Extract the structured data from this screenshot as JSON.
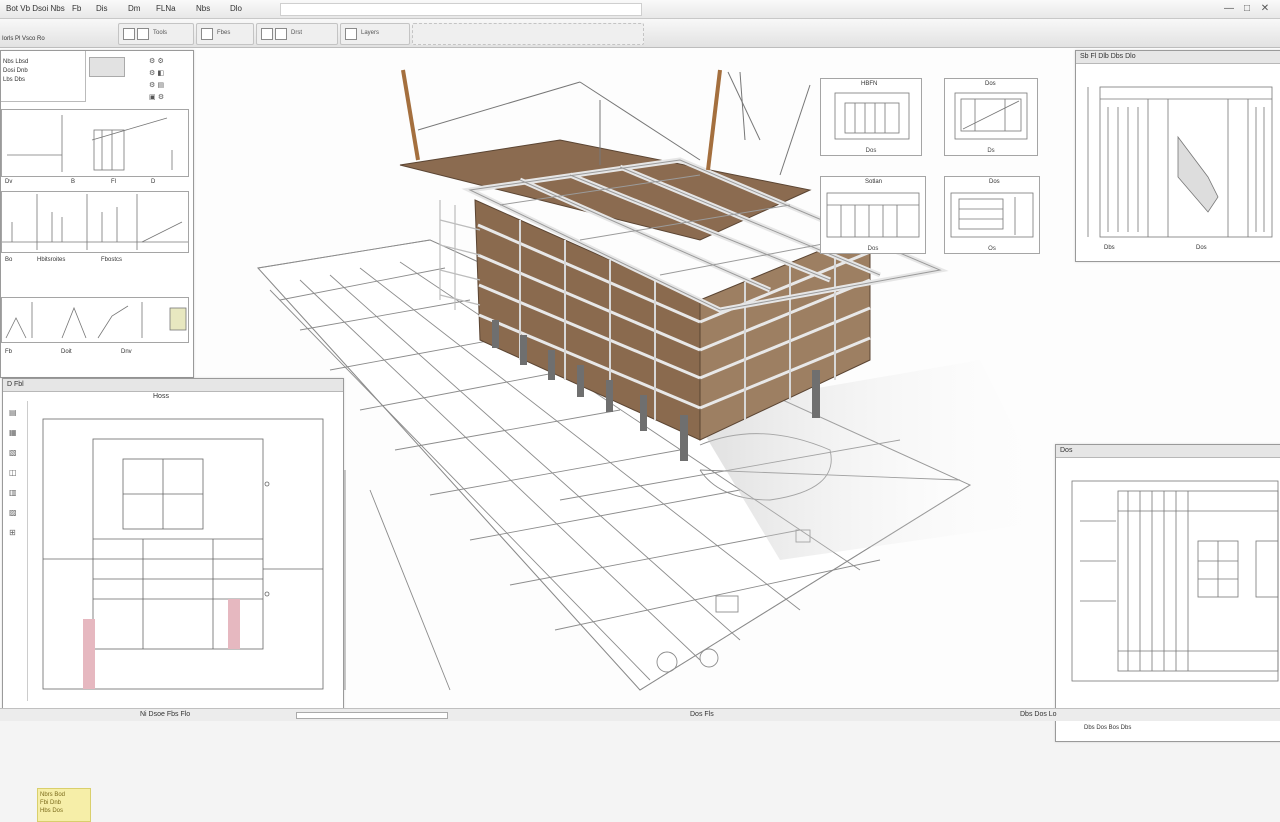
{
  "menu": {
    "items": [
      "Bot Vb Dsoi Nbs",
      "Fb",
      "Dis",
      "Dm",
      "FLNa",
      "Nbs",
      "Dlo"
    ],
    "window_controls": [
      "—",
      "□",
      "✕"
    ]
  },
  "toolbar": {
    "label": "Iorls Pl Vsco Ro",
    "groups": [
      "Tools",
      "Fbes",
      "Drst",
      "Layers"
    ]
  },
  "left_top_panel": {
    "rows": [
      "Nbs Lbsd",
      "Dosi Dnb",
      "Lbs Dbs"
    ],
    "footer_labels": [
      "Dv",
      "B",
      "Fl",
      "D"
    ],
    "section_labels": [
      "Bo",
      "Hbitsroites",
      "Fbostcs"
    ],
    "bottom_labels": [
      "Fb",
      "Doit",
      "Dnv"
    ]
  },
  "left_bottom_panel": {
    "title": "D Fbl",
    "header": "Hoss",
    "notes": [
      "Nbrs Bod",
      "Fbi Dnb",
      "Hbs Dos"
    ]
  },
  "thumbnails": [
    {
      "title": "HBFN",
      "caption": "Dos"
    },
    {
      "title": "Dos",
      "caption": "Ds"
    },
    {
      "title": "Sotlan",
      "caption": "Dos"
    },
    {
      "title": "Dos",
      "caption": "Os"
    }
  ],
  "right_top_panel": {
    "title": "Sb Fl Dlb Dbs Dlo",
    "footer_left": "Dbs",
    "footer_right": "Dos"
  },
  "right_bottom_panel": {
    "title": "Dos",
    "footer": "Dbs Dos Bos Dbs"
  },
  "status": {
    "left": "Ni Dsoe Fbs Flo",
    "middle": "Dos Fls",
    "right": "Dbs Dos Lo"
  },
  "colors": {
    "timber": "#8a6a4e",
    "steel": "#e2e2e2",
    "line": "#8c8c8c",
    "note_bg": "#f6eea8"
  }
}
